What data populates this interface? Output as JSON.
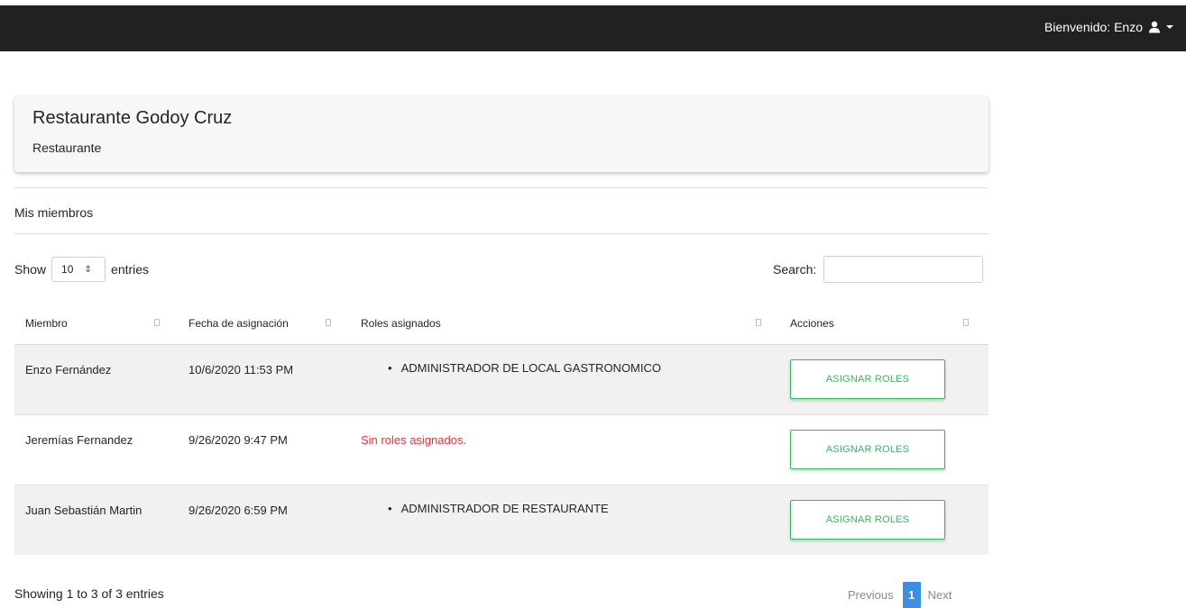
{
  "header": {
    "welcome_text": "Bienvenido: Enzo",
    "user_icon": "user-icon",
    "caret_icon": "caret-down-icon"
  },
  "card": {
    "title": "Restaurante Godoy Cruz",
    "subtitle": "Restaurante"
  },
  "section_title": "Mis miembros",
  "table_controls": {
    "show_label": "Show",
    "page_length": "10",
    "entries_label": "entries",
    "search_label": "Search:",
    "search_value": ""
  },
  "table": {
    "columns": [
      "Miembro",
      "Fecha de asignación",
      "Roles asignados",
      "Acciones"
    ],
    "rows": [
      {
        "member": "Enzo Fernández",
        "date": "10/6/2020 11:53 PM",
        "role": "ADMINISTRADOR DE LOCAL GASTRONOMICO",
        "no_roles": "",
        "action": "ASIGNAR ROLES"
      },
      {
        "member": "Jeremías Fernandez",
        "date": "9/26/2020 9:47 PM",
        "role": "",
        "no_roles": "Sin roles asignados.",
        "action": "ASIGNAR ROLES"
      },
      {
        "member": "Juan Sebastián Martin",
        "date": "9/26/2020 6:59 PM",
        "role": "ADMINISTRADOR DE RESTAURANTE",
        "no_roles": "",
        "action": "ASIGNAR ROLES"
      }
    ]
  },
  "footer": {
    "info": "Showing 1 to 3 of 3 entries",
    "previous": "Previous",
    "current_page": "1",
    "next": "Next"
  },
  "colors": {
    "topbar": "#212121",
    "accent_green": "#2ebc5b",
    "error_red": "#e8353f",
    "pager_blue": "#3a8ee6"
  }
}
